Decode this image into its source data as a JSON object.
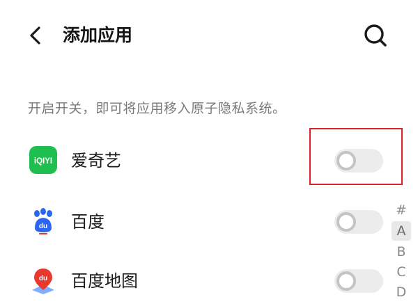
{
  "header": {
    "back_icon": "chevron-left-icon",
    "title": "添加应用",
    "search_icon": "search-icon"
  },
  "hint_text": "开启开关，即可将应用移入原子隐私系统。",
  "apps": [
    {
      "name": "爱奇艺",
      "icon": "iqiyi-logo-icon",
      "icon_text": "iQIYI",
      "toggle_on": false
    },
    {
      "name": "百度",
      "icon": "baidu-logo-icon",
      "icon_text": "du",
      "toggle_on": false
    },
    {
      "name": "百度地图",
      "icon": "baidu-map-logo-icon",
      "icon_text": "du",
      "toggle_on": false
    }
  ],
  "index_bar": [
    "#",
    "A",
    "B",
    "C",
    "D"
  ],
  "index_active": "A",
  "colors": {
    "highlight": "#d9252a",
    "iqiyi_green": "#1fbf4f",
    "baidu_blue": "#2b65f0",
    "map_red": "#e8382f"
  }
}
